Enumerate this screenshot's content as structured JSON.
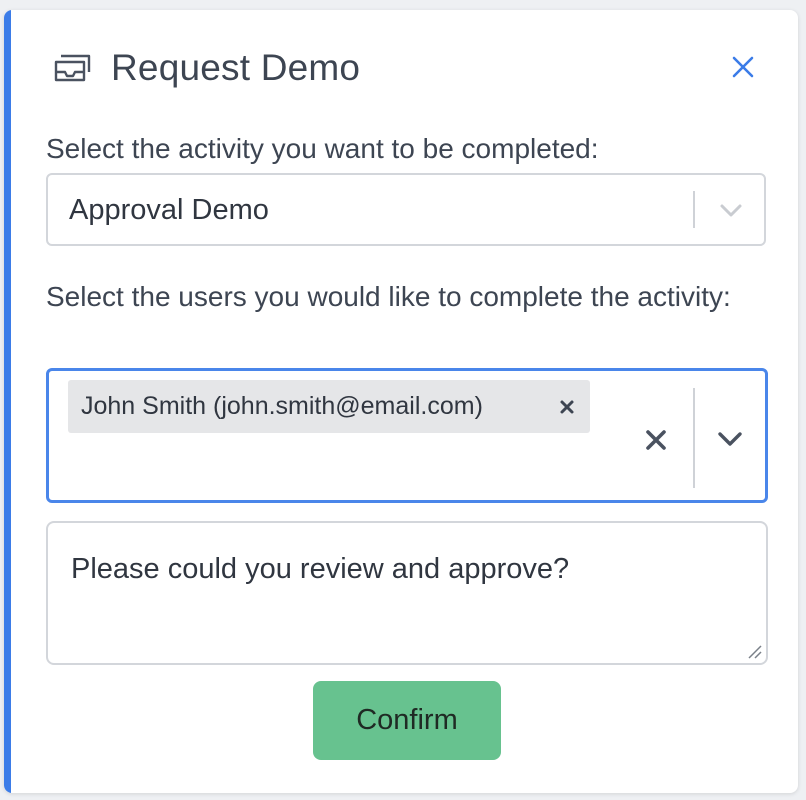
{
  "dialog": {
    "title": "Request Demo",
    "title_icon": "inbox-tray-icon",
    "close_icon": "close-icon",
    "accent_color": "#3b7ce8"
  },
  "activity": {
    "label": "Select the activity you want to be completed:",
    "selected_value": "Approval Demo",
    "chevron_icon": "chevron-down-icon"
  },
  "users": {
    "label": "Select the users you would like to complete the activity:",
    "selected": [
      {
        "label": "John Smith (john.smith@email.com)",
        "remove_icon": "close-icon"
      }
    ],
    "clear_icon": "clear-icon",
    "chevron_icon": "chevron-down-icon",
    "focus_color": "#4a86ea"
  },
  "message": {
    "value": "Please could you review and approve?"
  },
  "actions": {
    "confirm_label": "Confirm",
    "confirm_color": "#67c28f"
  }
}
